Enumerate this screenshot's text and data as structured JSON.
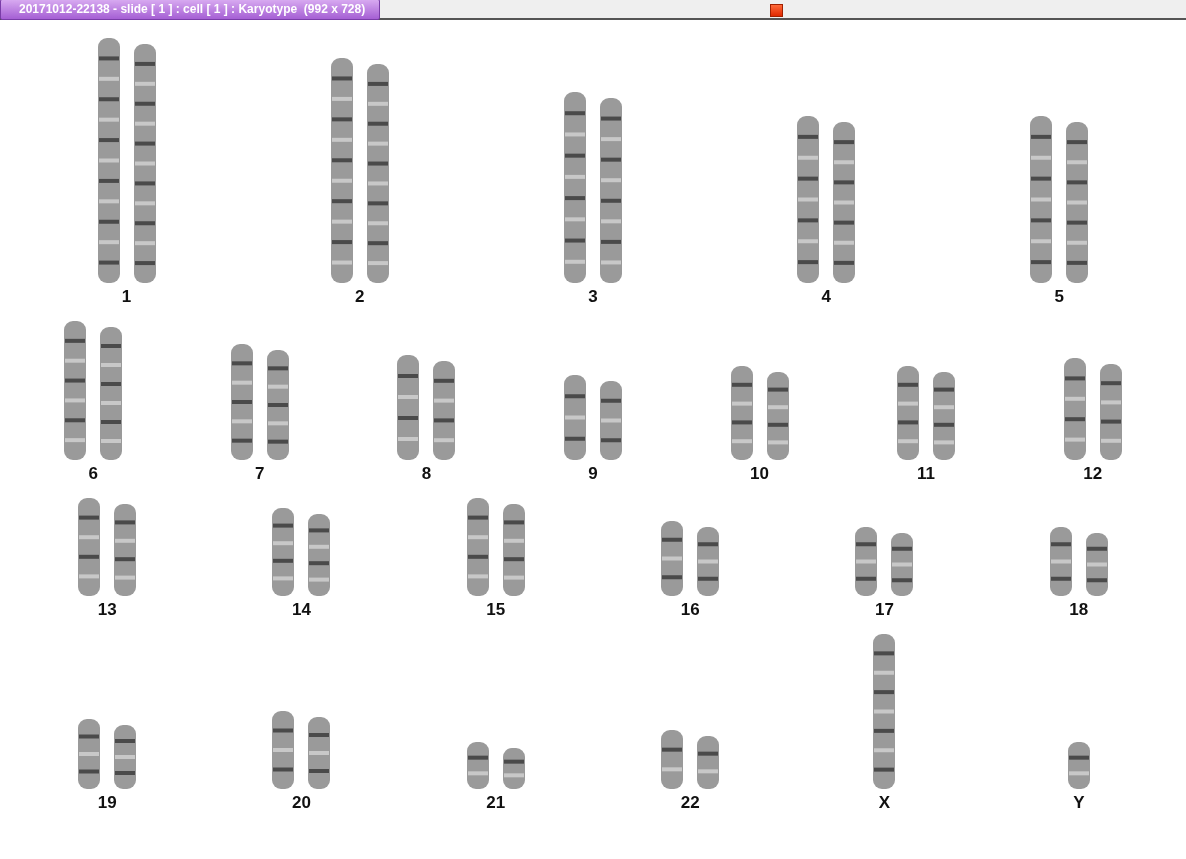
{
  "window": {
    "title": "20171012-22138 - slide [ 1 ] : cell [ 1 ] : Karyotype  (992 x 728)"
  },
  "karyotype": {
    "rows": [
      {
        "chromosomes": [
          {
            "label": "1",
            "kind": "pair"
          },
          {
            "label": "2",
            "kind": "pair"
          },
          {
            "label": "3",
            "kind": "pair"
          },
          {
            "label": "4",
            "kind": "pair"
          },
          {
            "label": "5",
            "kind": "pair"
          }
        ]
      },
      {
        "chromosomes": [
          {
            "label": "6",
            "kind": "pair"
          },
          {
            "label": "7",
            "kind": "pair"
          },
          {
            "label": "8",
            "kind": "pair"
          },
          {
            "label": "9",
            "kind": "pair"
          },
          {
            "label": "10",
            "kind": "pair"
          },
          {
            "label": "11",
            "kind": "pair"
          },
          {
            "label": "12",
            "kind": "pair"
          }
        ]
      },
      {
        "chromosomes": [
          {
            "label": "13",
            "kind": "pair"
          },
          {
            "label": "14",
            "kind": "pair"
          },
          {
            "label": "15",
            "kind": "pair"
          },
          {
            "label": "16",
            "kind": "pair"
          },
          {
            "label": "17",
            "kind": "pair"
          },
          {
            "label": "18",
            "kind": "pair"
          }
        ]
      },
      {
        "chromosomes": [
          {
            "label": "19",
            "kind": "pair"
          },
          {
            "label": "20",
            "kind": "pair"
          },
          {
            "label": "21",
            "kind": "pair"
          },
          {
            "label": "22",
            "kind": "pair"
          },
          {
            "label": "X",
            "kind": "single"
          },
          {
            "label": "Y",
            "kind": "single"
          }
        ]
      }
    ]
  }
}
